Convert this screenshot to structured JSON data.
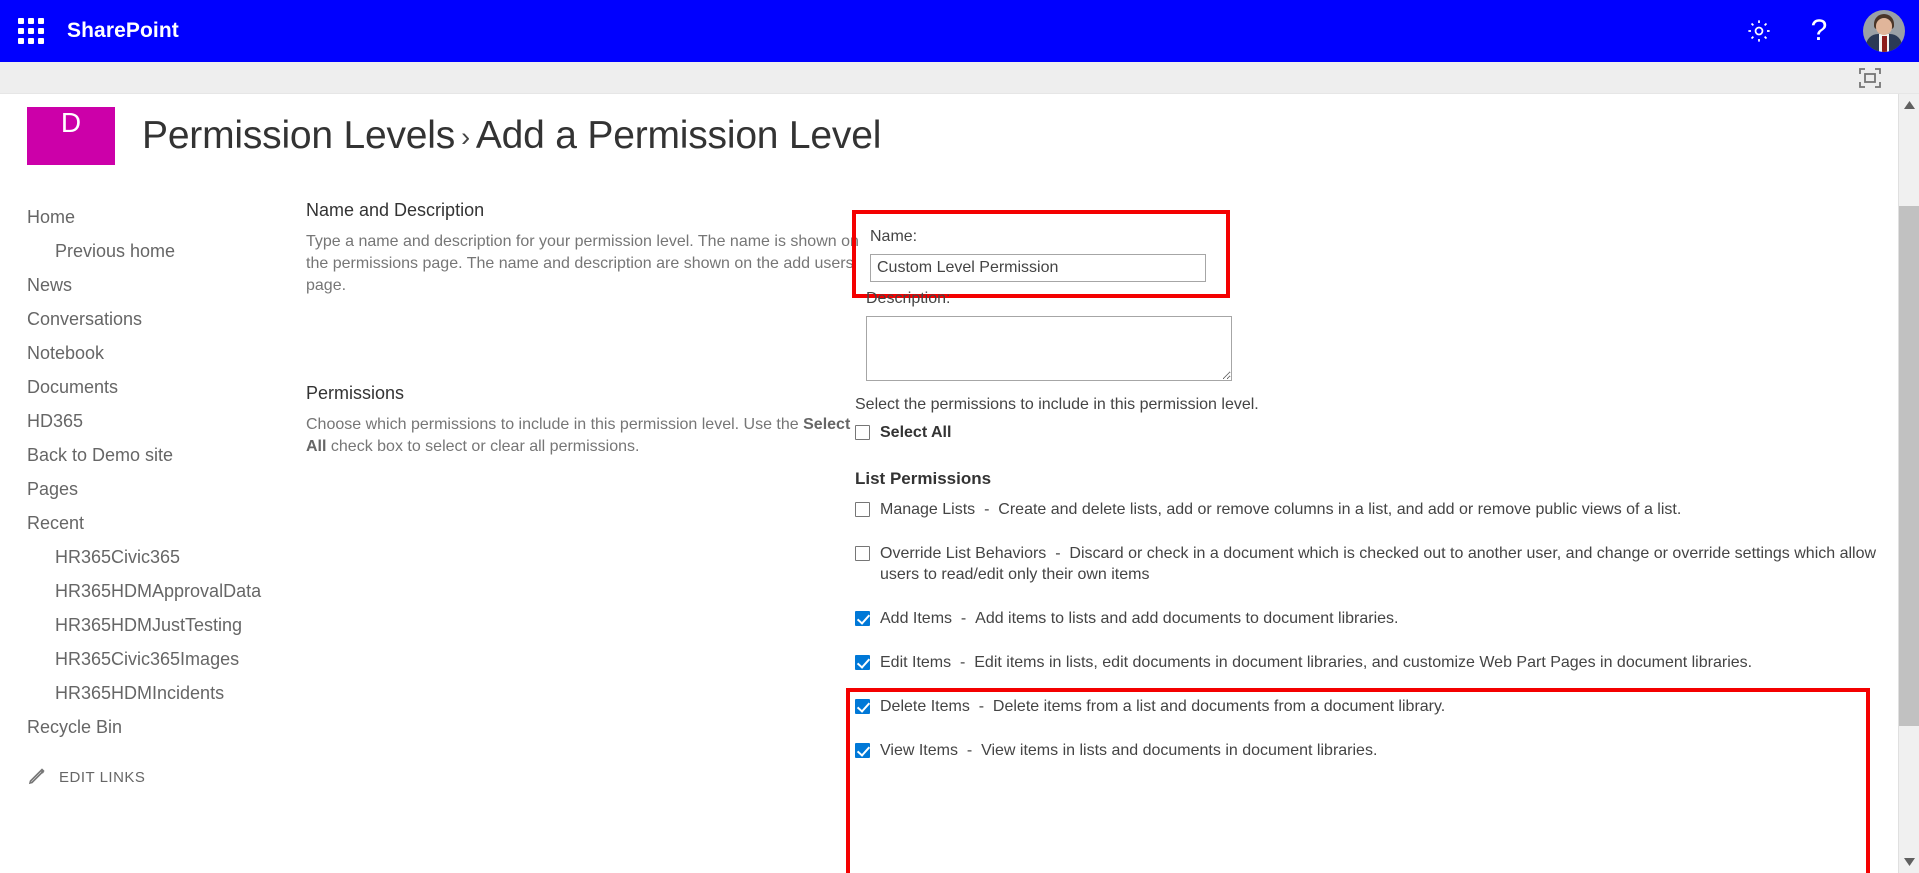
{
  "suite": {
    "brand": "SharePoint",
    "waffle_icon": "app-launcher-waffle-icon",
    "settings_icon": "gear-icon",
    "help_icon": "question-mark-icon",
    "avatar_icon": "user-avatar",
    "focus_icon": "focus-on-content-icon",
    "header_color": "#0000ff"
  },
  "page": {
    "site_logo_letter": "D",
    "site_logo_color": "#cc00a9",
    "breadcrumb_parent": "Permission Levels",
    "breadcrumb_separator": "›",
    "breadcrumb_current": "Add a Permission Level"
  },
  "sidebar": {
    "items": [
      {
        "label": "Home",
        "sub": false
      },
      {
        "label": "Previous home",
        "sub": true
      },
      {
        "label": "News",
        "sub": false
      },
      {
        "label": "Conversations",
        "sub": false
      },
      {
        "label": "Notebook",
        "sub": false
      },
      {
        "label": "Documents",
        "sub": false
      },
      {
        "label": "HD365",
        "sub": false
      },
      {
        "label": "Back to Demo site",
        "sub": false
      },
      {
        "label": "Pages",
        "sub": false
      },
      {
        "label": "Recent",
        "sub": false
      },
      {
        "label": "HR365Civic365",
        "sub": true
      },
      {
        "label": "HR365HDMApprovalData",
        "sub": true
      },
      {
        "label": "HR365HDMJustTesting",
        "sub": true
      },
      {
        "label": "HR365Civic365Images",
        "sub": true
      },
      {
        "label": "HR365HDMIncidents",
        "sub": true
      },
      {
        "label": "Recycle Bin",
        "sub": false
      }
    ],
    "edit_links_label": "EDIT LINKS",
    "edit_links_icon": "pencil-icon"
  },
  "name_section": {
    "title": "Name and Description",
    "description": "Type a name and description for your permission level.  The name is shown on the permissions page.  The name and description are shown on the add users page.",
    "name_label": "Name:",
    "name_value": "Custom Level Permission",
    "name_placeholder": "",
    "description_label": "Description:",
    "description_value": "",
    "description_placeholder": "",
    "highlight_color": "#f40000"
  },
  "permissions_section": {
    "title": "Permissions",
    "description_part1": "Choose which permissions to include in this permission level.  Use the ",
    "description_bold": "Select All",
    "description_part2": " check box to select or clear all permissions.",
    "intro": "Select the permissions to include in this permission level.",
    "select_all_label": "Select All",
    "select_all_checked": false,
    "group_title": "List Permissions",
    "items": [
      {
        "name": "Manage Lists",
        "separator": "-",
        "description": "Create and delete lists, add or remove columns in a list, and add or remove public views of a list.",
        "checked": false,
        "highlighted": false
      },
      {
        "name": "Override List Behaviors",
        "separator": "-",
        "description": "Discard or check in a document which is checked out to another user, and change or override settings which allow users to read/edit only their own items",
        "checked": false,
        "highlighted": false
      },
      {
        "name": "Add Items",
        "separator": "-",
        "description": "Add items to lists and add documents to document libraries.",
        "checked": true,
        "highlighted": true
      },
      {
        "name": "Edit Items",
        "separator": "-",
        "description": "Edit items in lists, edit documents in document libraries, and customize Web Part Pages in document libraries.",
        "checked": true,
        "highlighted": true
      },
      {
        "name": "Delete Items",
        "separator": "-",
        "description": "Delete items from a list and documents from a document library.",
        "checked": true,
        "highlighted": true
      },
      {
        "name": "View Items",
        "separator": "-",
        "description": "View items in lists and documents in document libraries.",
        "checked": true,
        "highlighted": true
      }
    ]
  },
  "scrollbar": {
    "up_arrow_icon": "scroll-up-arrow-icon",
    "down_arrow_icon": "scroll-down-arrow-icon"
  }
}
